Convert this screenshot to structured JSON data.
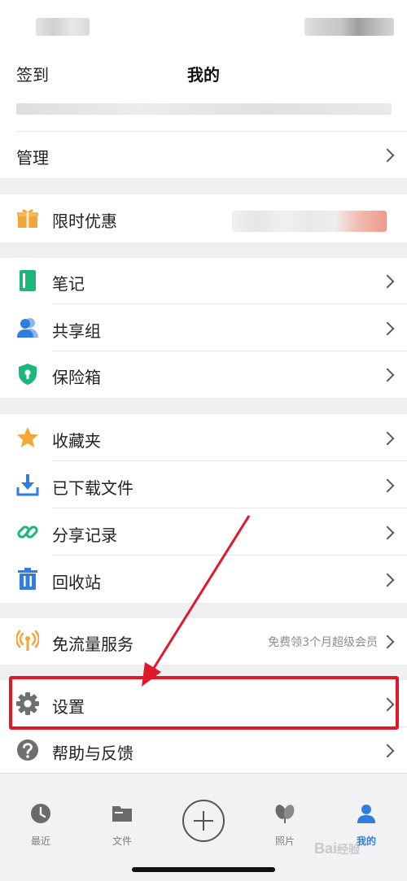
{
  "nav": {
    "left_label": "签到",
    "title": "我的"
  },
  "rows": {
    "manage": "管理",
    "promo": "限时优惠",
    "notes": "笔记",
    "share_group": "共享组",
    "vault": "保险箱",
    "favorites": "收藏夹",
    "downloads": "已下载文件",
    "share_history": "分享记录",
    "recycle": "回收站",
    "free_traffic": "免流量服务",
    "free_traffic_sub": "免费领3个月超级会员",
    "settings": "设置",
    "help": "帮助与反馈"
  },
  "tabs": [
    {
      "label": "最近",
      "icon": "clock-icon"
    },
    {
      "label": "文件",
      "icon": "folder-icon"
    },
    {
      "label": "",
      "icon": "add-icon"
    },
    {
      "label": "照片",
      "icon": "photos-icon"
    },
    {
      "label": "我的",
      "icon": "person-icon",
      "active": true
    }
  ],
  "watermark": {
    "brand": "Bai",
    "suffix": "经验"
  },
  "colors": {
    "accent": "#2f7de1",
    "highlight_border": "#e3172a",
    "arrow": "#e3172a",
    "note_green": "#1db77a",
    "gift_orange": "#f3a53a",
    "star_orange": "#f4a935"
  }
}
